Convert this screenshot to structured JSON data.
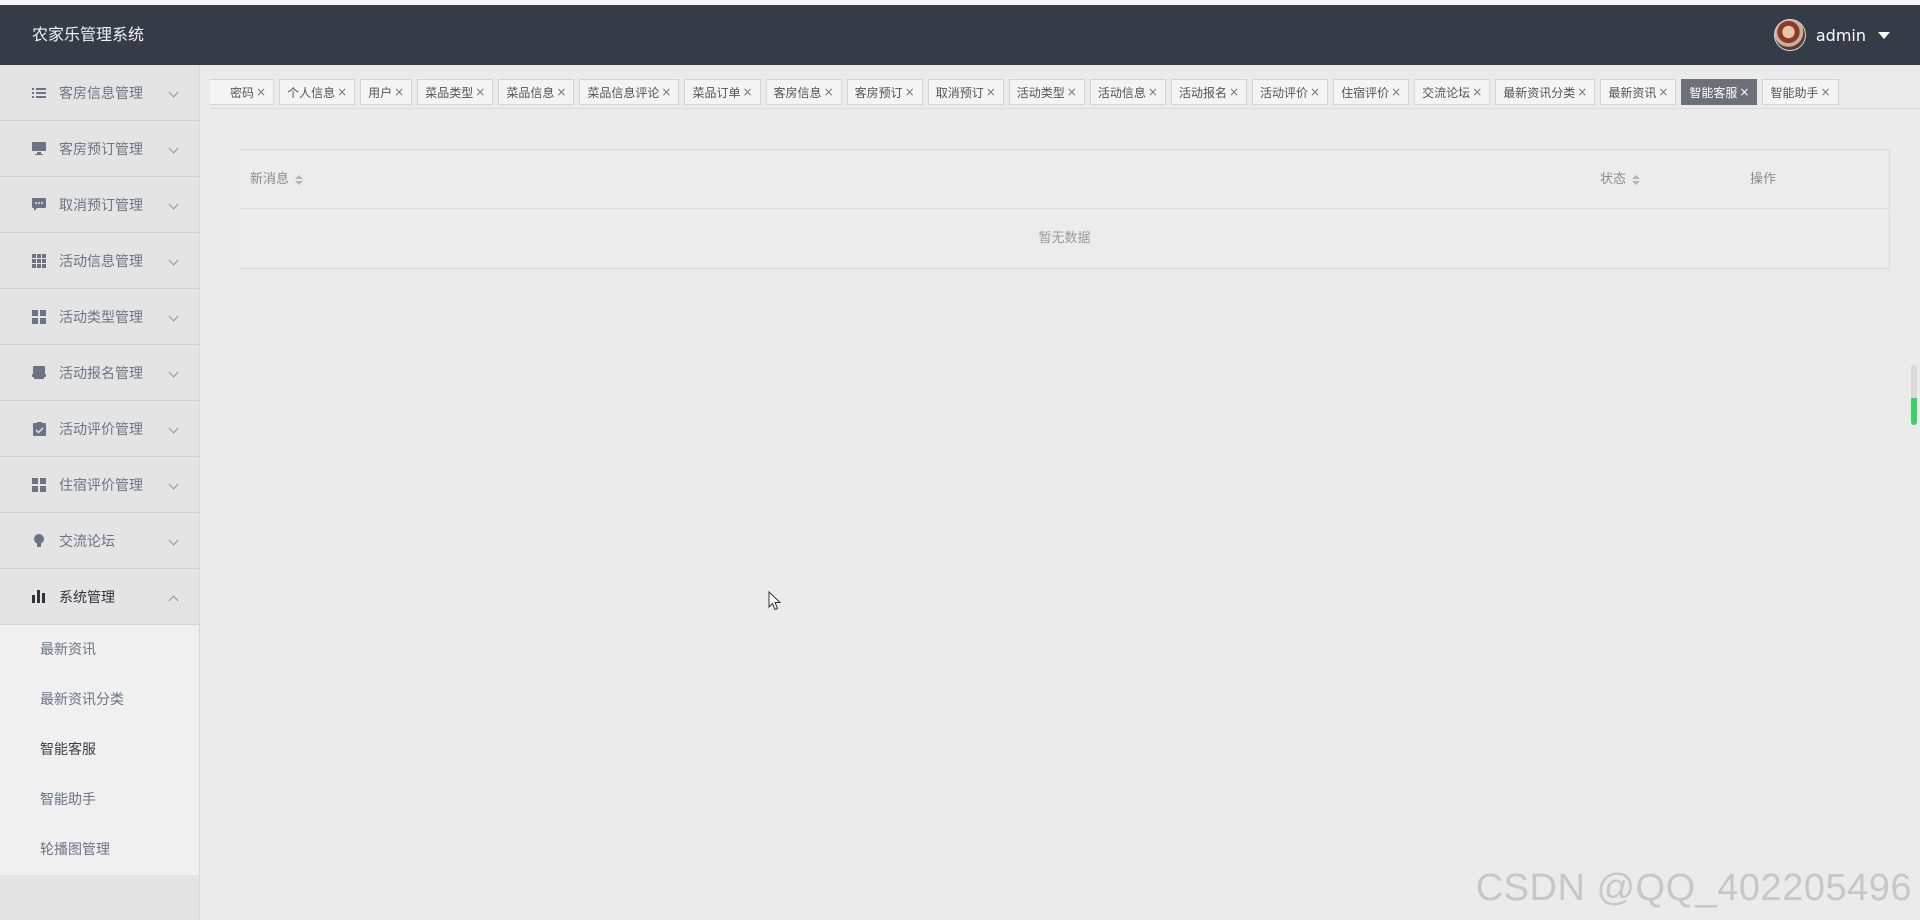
{
  "app": {
    "title": "农家乐管理系统"
  },
  "user": {
    "name": "admin"
  },
  "sidebar": {
    "items": [
      {
        "label": "客房信息管理",
        "icon": "list-icon"
      },
      {
        "label": "客房预订管理",
        "icon": "monitor-icon"
      },
      {
        "label": "取消预订管理",
        "icon": "chat-icon"
      },
      {
        "label": "活动信息管理",
        "icon": "grid-icon"
      },
      {
        "label": "活动类型管理",
        "icon": "apps-icon"
      },
      {
        "label": "活动报名管理",
        "icon": "printer-icon"
      },
      {
        "label": "活动评价管理",
        "icon": "clipboard-icon"
      },
      {
        "label": "住宿评价管理",
        "icon": "apps-icon"
      },
      {
        "label": "交流论坛",
        "icon": "bulb-icon"
      },
      {
        "label": "系统管理",
        "icon": "bar-chart-icon"
      }
    ],
    "submenu": [
      {
        "label": "最新资讯"
      },
      {
        "label": "最新资讯分类"
      },
      {
        "label": "智能客服"
      },
      {
        "label": "智能助手"
      },
      {
        "label": "轮播图管理"
      }
    ]
  },
  "tabs": [
    {
      "label": "密码"
    },
    {
      "label": "个人信息"
    },
    {
      "label": "用户"
    },
    {
      "label": "菜品类型"
    },
    {
      "label": "菜品信息"
    },
    {
      "label": "菜品信息评论"
    },
    {
      "label": "菜品订单"
    },
    {
      "label": "客房信息"
    },
    {
      "label": "客房预订"
    },
    {
      "label": "取消预订"
    },
    {
      "label": "活动类型"
    },
    {
      "label": "活动信息"
    },
    {
      "label": "活动报名"
    },
    {
      "label": "活动评价"
    },
    {
      "label": "住宿评价"
    },
    {
      "label": "交流论坛"
    },
    {
      "label": "最新资讯分类"
    },
    {
      "label": "最新资讯"
    },
    {
      "label": "智能客服"
    },
    {
      "label": "智能助手"
    }
  ],
  "tab_close": "×",
  "table": {
    "columns": {
      "message": "新消息",
      "status": "状态",
      "operation": "操作"
    },
    "empty_text": "暂无数据"
  },
  "watermark": "CSDN @QQ_402205496"
}
